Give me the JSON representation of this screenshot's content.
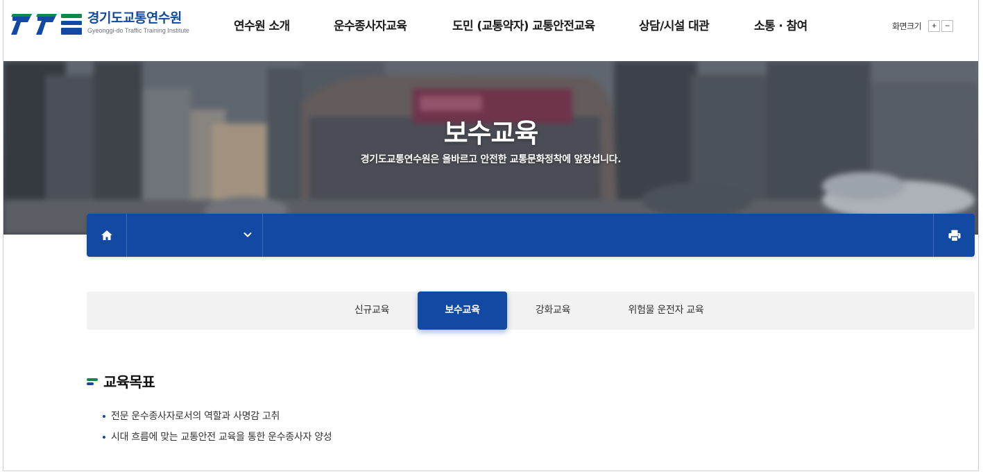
{
  "header": {
    "logo_ko": "경기도교통연수원",
    "logo_en": "Gyeonggi-do Traffic Training Institute",
    "nav": [
      {
        "label": "연수원 소개"
      },
      {
        "label": "운수종사자교육"
      },
      {
        "label": "도민 (교통약자) 교통안전교육"
      },
      {
        "label": "상담/시설 대관"
      },
      {
        "label": "소통 · 참여"
      }
    ],
    "font_size": {
      "label": "화면크기",
      "increase": "+",
      "decrease": "−"
    }
  },
  "hero": {
    "title": "보수교육",
    "subtitle": "경기도교통연수원은 올바르고 안전한 교통문화정착에 앞장섭니다."
  },
  "location_bar": {
    "home_icon": "home-icon",
    "dropdown_icon": "chevron-down-icon",
    "print_icon": "printer-icon",
    "color": "#124aa3"
  },
  "tabs": [
    {
      "label": "신규교육",
      "active": false
    },
    {
      "label": "보수교육",
      "active": true
    },
    {
      "label": "강화교육",
      "active": false
    },
    {
      "label": "위험물 운전자 교육",
      "active": false
    }
  ],
  "content": {
    "section_title": "교육목표",
    "goals": [
      "전문 운수종사자로서의 역할과 사명감 고취",
      "시대 흐름에 맞는 교통안전 교육을 통한 운수종사자 양성"
    ]
  },
  "colors": {
    "brand_blue": "#124aa3",
    "brand_green": "#0f8a4a"
  }
}
